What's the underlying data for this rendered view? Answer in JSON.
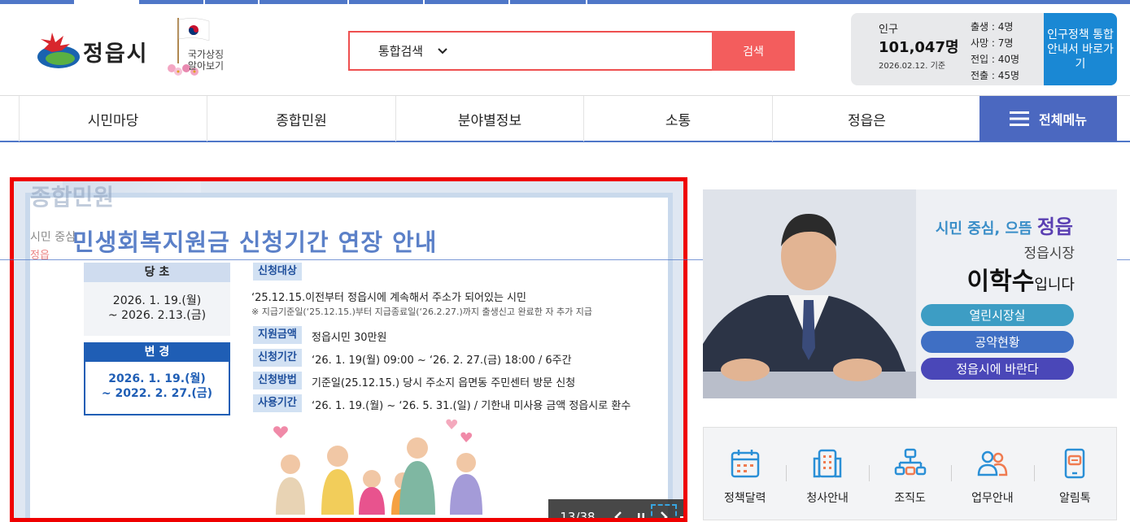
{
  "header": {
    "logo_text": "정읍시",
    "flag_caption_1": "국가상징",
    "flag_caption_2": "알아보기"
  },
  "search": {
    "category": "통합검색",
    "placeholder": "",
    "button_label": "검색"
  },
  "population": {
    "label": "인구",
    "value": "101,047명",
    "date": "2026.02.12. 기준",
    "stats": [
      "출생 : 4명",
      "사망 : 7명",
      "전입 : 40명",
      "전출 : 45명"
    ]
  },
  "policy_button": "인구정책 통합안내서 바로가기",
  "nav": {
    "items": [
      "시민마당",
      "종합민원",
      "분야별정보",
      "소통",
      "정읍은"
    ],
    "all_menu": "전체메뉴"
  },
  "banner": {
    "title": "민생회복지원금 신청기간 연장 안내",
    "ghost_title": "종합민원",
    "ghost_sub": "시민 중심",
    "ghost_sub2": "정읍",
    "original_header": "당 초",
    "original_period_1": "2026. 1. 19.(월)",
    "original_period_2": "~ 2026. 2.13.(금)",
    "changed_header": "변 경",
    "changed_period_1": "2026. 1. 19.(월)",
    "changed_period_2": "~ 2022. 2. 27.(금)",
    "rows": [
      {
        "tag": "신청대상",
        "text": ""
      },
      {
        "tag": "지원금액",
        "text": "정읍시민 30만원"
      },
      {
        "tag": "신청기간",
        "text": "‘26. 1. 19(월) 09:00 ~ ‘26. 2. 27.(금) 18:00 / 6주간"
      },
      {
        "tag": "신청방법",
        "text": "기준일(25.12.15.) 당시 주소지 읍면동 주민센터 방문 신청"
      },
      {
        "tag": "사용기간",
        "text": "‘26. 1. 19.(월) ~ ‘26. 5. 31.(일) / 기한내 미사용 금액 정읍시로 환수"
      }
    ],
    "target_text": "‘25.12.15.이전부터 정읍시에 계속해서 주소가 되어있는 시민",
    "target_note": "※ 지급기준일(‘25.12.15.)부터 지급종료일(‘26.2.27.)까지 출생신고 완료한 자 추가 지급",
    "counter": "13/38"
  },
  "mayor": {
    "slogan_prefix": "시민 중심, 으뜸 ",
    "slogan_city": "정읍",
    "role": "정읍시장",
    "name": "이학수",
    "name_suffix": "입니다",
    "buttons": [
      {
        "label": "열린시장실",
        "color": "#3d9dc4"
      },
      {
        "label": "공약현황",
        "color": "#3f6fc4"
      },
      {
        "label": "정읍시에 바란다",
        "color": "#4a47b8"
      }
    ]
  },
  "quick_links": [
    {
      "label": "정책달력",
      "icon": "calendar-icon"
    },
    {
      "label": "청사안내",
      "icon": "building-icon"
    },
    {
      "label": "조직도",
      "icon": "org-chart-icon"
    },
    {
      "label": "업무안내",
      "icon": "people-icon"
    },
    {
      "label": "알림톡",
      "icon": "phone-message-icon"
    }
  ]
}
